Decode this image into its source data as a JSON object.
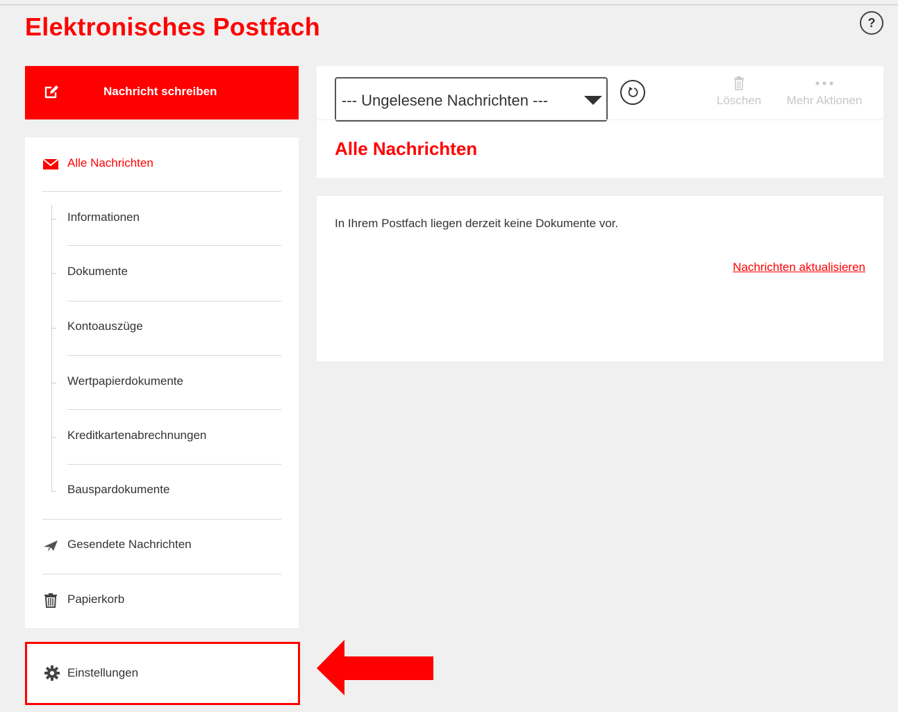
{
  "header": {
    "title": "Elektronisches Postfach",
    "help_label": "?"
  },
  "compose": {
    "label": "Nachricht schreiben",
    "icon": "compose-icon"
  },
  "sidebar": {
    "items": [
      {
        "label": "Alle Nachrichten",
        "icon": "envelope-icon",
        "active": true
      },
      {
        "label": "Informationen"
      },
      {
        "label": "Dokumente"
      },
      {
        "label": "Kontoauszüge"
      },
      {
        "label": "Wertpapierdokumente"
      },
      {
        "label": "Kreditkartenabrechnungen"
      },
      {
        "label": "Bauspardokumente"
      },
      {
        "label": "Gesendete Nachrichten",
        "icon": "paper-plane-icon"
      },
      {
        "label": "Papierkorb",
        "icon": "trash-icon"
      }
    ],
    "settings": {
      "label": "Einstellungen",
      "icon": "gear-icon"
    }
  },
  "toolbar": {
    "filter_value": "--- Ungelesene Nachrichten ---",
    "refresh_icon": "refresh-icon",
    "delete_label": "Löschen",
    "more_label": "Mehr Aktionen"
  },
  "main": {
    "section_title": "Alle Nachrichten",
    "empty_message": "In Ihrem Postfach liegen derzeit keine Dokumente vor.",
    "refresh_link": "Nachrichten aktualisieren"
  },
  "colors": {
    "accent": "#ff0000",
    "background": "#f0f0f0",
    "panel": "#ffffff",
    "text": "#333333",
    "disabled": "#c7c7c7"
  }
}
